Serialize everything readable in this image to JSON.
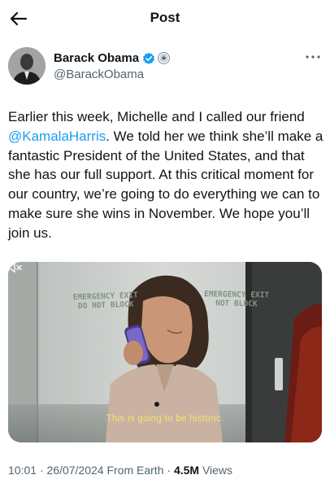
{
  "header": {
    "title": "Post"
  },
  "author": {
    "display_name": "Barack Obama",
    "handle": "@BarackObama",
    "verified_color": "#1d9bf0"
  },
  "tweet": {
    "text_before": "Earlier this week, Michelle and I called our friend ",
    "mention": "@KamalaHarris",
    "text_after": ". We told her we think she’ll make a fantastic President of the United States, and that she has our full support. At this critical moment for our country, we’re going to do everything we can to make sure she wins in November. We hope you’ll join us."
  },
  "media": {
    "sign_left_line1": "EMERGENCY EXIT",
    "sign_left_line2": "DO NOT BLOCK",
    "sign_right_line1": "EMERGENCY EXIT",
    "sign_right_line2": "NOT BLOCK",
    "caption": "This is going to be historic.",
    "icons": [
      "mute-icon"
    ]
  },
  "meta": {
    "time": "10:01",
    "date": "26/07/2024",
    "location": "From Earth",
    "views_count": "4.5M",
    "views_label": "Views",
    "separator": "·"
  },
  "colors": {
    "text": "#0f1419",
    "secondary": "#536471",
    "link": "#1d9bf0"
  }
}
